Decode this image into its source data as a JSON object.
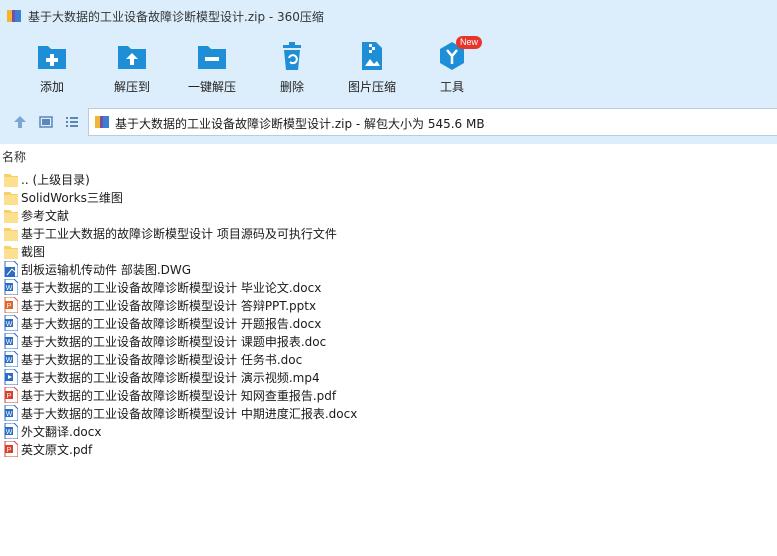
{
  "window": {
    "title": "基于大数据的工业设备故障诊断模型设计.zip - 360压缩"
  },
  "toolbar": {
    "items": [
      {
        "label": "添加",
        "icon": "add-folder-icon"
      },
      {
        "label": "解压到",
        "icon": "extract-to-icon"
      },
      {
        "label": "一键解压",
        "icon": "one-click-extract-icon"
      },
      {
        "label": "删除",
        "icon": "trash-icon"
      },
      {
        "label": "图片压缩",
        "icon": "image-compress-icon"
      },
      {
        "label": "工具",
        "icon": "tools-icon",
        "badge": "New"
      }
    ]
  },
  "address": {
    "text": "基于大数据的工业设备故障诊断模型设计.zip - 解包大小为 545.6 MB"
  },
  "list": {
    "column_name": "名称",
    "items": [
      {
        "name": ".. (上级目录)",
        "type": "folder"
      },
      {
        "name": "SolidWorks三维图",
        "type": "folder"
      },
      {
        "name": "参考文献",
        "type": "folder"
      },
      {
        "name": "基于工业大数据的故障诊断模型设计 项目源码及可执行文件",
        "type": "folder"
      },
      {
        "name": "截图",
        "type": "folder"
      },
      {
        "name": "刮板运输机传动件 部装图.DWG",
        "type": "dwg"
      },
      {
        "name": "基于大数据的工业设备故障诊断模型设计 毕业论文.docx",
        "type": "word"
      },
      {
        "name": "基于大数据的工业设备故障诊断模型设计 答辩PPT.pptx",
        "type": "ppt"
      },
      {
        "name": "基于大数据的工业设备故障诊断模型设计 开题报告.docx",
        "type": "word"
      },
      {
        "name": "基于大数据的工业设备故障诊断模型设计 课题申报表.doc",
        "type": "word"
      },
      {
        "name": "基于大数据的工业设备故障诊断模型设计 任务书.doc",
        "type": "word"
      },
      {
        "name": "基于大数据的工业设备故障诊断模型设计 演示视频.mp4",
        "type": "video"
      },
      {
        "name": "基于大数据的工业设备故障诊断模型设计 知网查重报告.pdf",
        "type": "pdf"
      },
      {
        "name": "基于大数据的工业设备故障诊断模型设计 中期进度汇报表.docx",
        "type": "word"
      },
      {
        "name": "外文翻译.docx",
        "type": "word"
      },
      {
        "name": "英文原文.pdf",
        "type": "pdf"
      }
    ]
  },
  "colors": {
    "chrome_bg": "#dceefb",
    "tool_blue": "#1e8fd6",
    "folder": "#f7d068",
    "word": "#2b6cc4",
    "pdf": "#d9412f",
    "ppt": "#e0642c"
  }
}
